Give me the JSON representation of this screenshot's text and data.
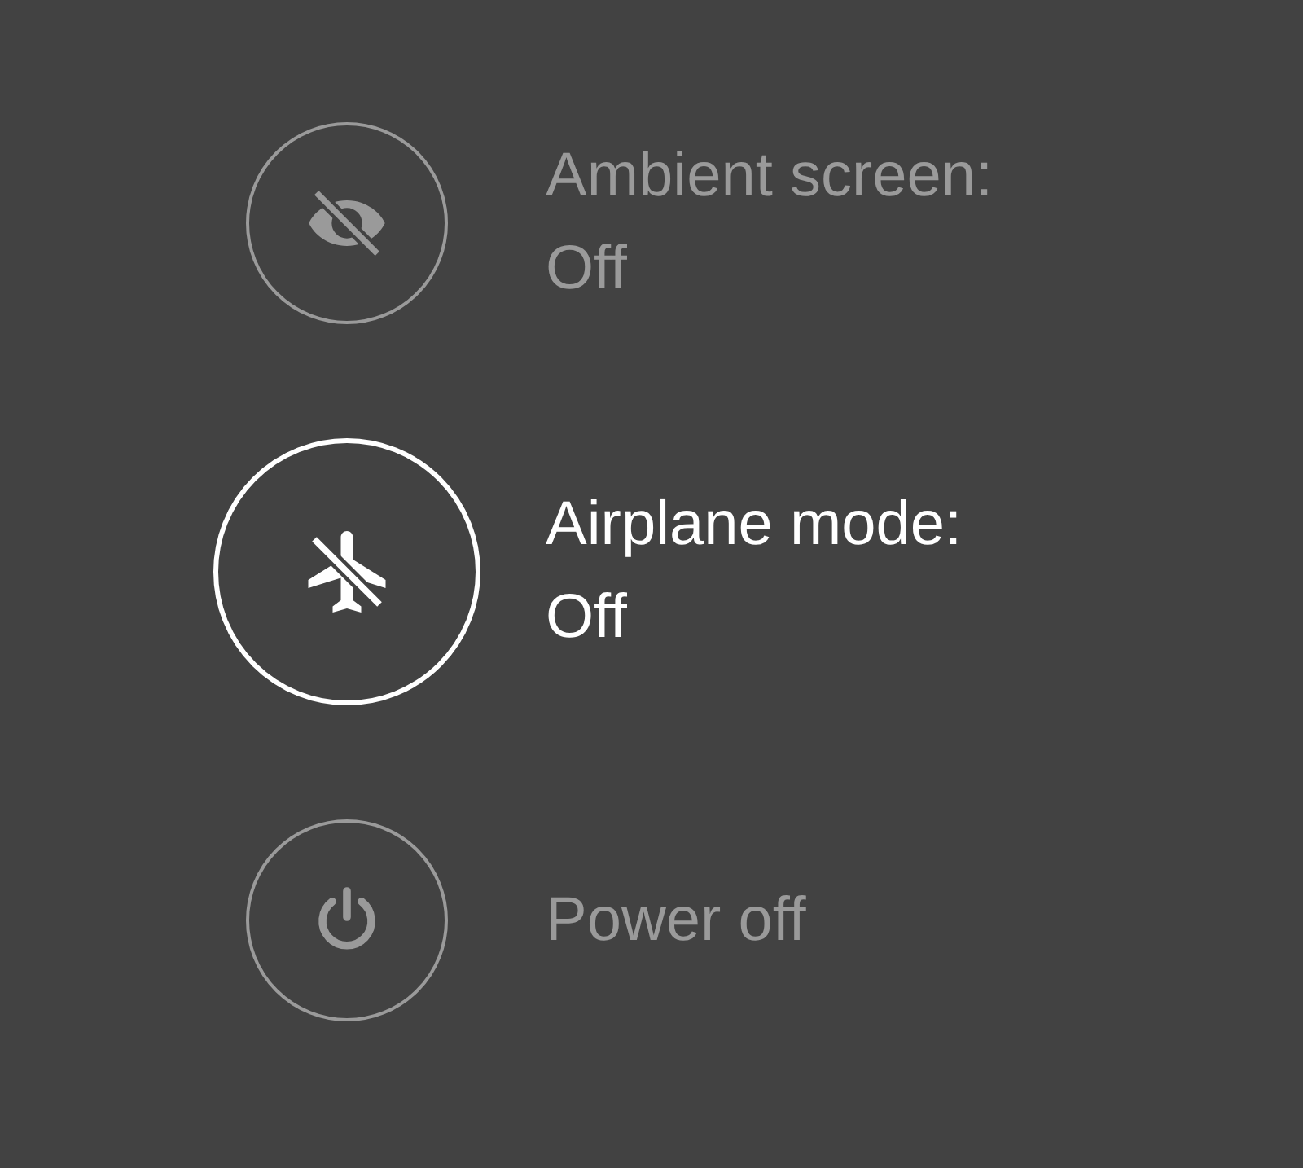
{
  "items": [
    {
      "kind": "ambient",
      "label": "Ambient screen:",
      "value": "Off",
      "selected": false
    },
    {
      "kind": "airplane",
      "label": "Airplane mode:",
      "value": "Off",
      "selected": true
    },
    {
      "kind": "power",
      "label": "Power off",
      "selected": false
    }
  ]
}
